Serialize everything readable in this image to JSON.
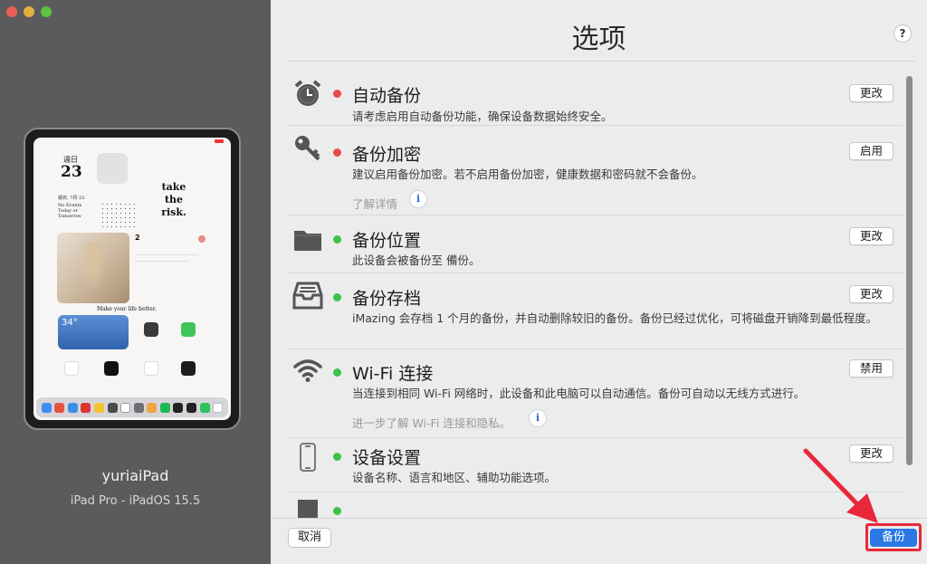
{
  "window": {
    "title": "选项"
  },
  "device": {
    "name": "yuriaiPad",
    "model": "iPad Pro - iPadOS 15.5",
    "screen": {
      "day_label": "週日",
      "day_number": "23",
      "quote": "take the risk.",
      "calendar_header": "週日, 7月 23",
      "calendar_text": "No Events Today or Tomorrow",
      "todo_count": "2",
      "caption": "Make your life better.",
      "weather_temp": "34°"
    }
  },
  "options": [
    {
      "icon": "alarm-clock-icon",
      "status": "red",
      "title": "自动备份",
      "description": "请考虑启用自动备份功能，确保设备数据始终安全。",
      "button": "更改"
    },
    {
      "icon": "key-icon",
      "status": "red",
      "title": "备份加密",
      "description": "建议启用备份加密。若不启用备份加密，健康数据和密码就不会备份。",
      "link": "了解详情",
      "button": "启用"
    },
    {
      "icon": "folder-icon",
      "status": "green",
      "title": "备份位置",
      "description": "此设备会被备份至 備份。",
      "button": "更改"
    },
    {
      "icon": "archive-tray-icon",
      "status": "green",
      "title": "备份存档",
      "description": "iMazing 会存档 1 个月的备份，并自动删除较旧的备份。备份已经过优化，可将磁盘开销降到最低程度。",
      "button": "更改"
    },
    {
      "icon": "wifi-icon",
      "status": "green",
      "title": "Wi-Fi 连接",
      "description": "当连接到相同 Wi-Fi 网络时，此设备和此电脑可以自动通信。备份可自动以无线方式进行。",
      "link": "进一步了解 Wi-Fi 连接和隐私。",
      "button": "禁用"
    },
    {
      "icon": "tablet-icon",
      "status": "green",
      "title": "设备设置",
      "description": "设备名称、语言和地区、辅助功能选项。",
      "button": "更改"
    }
  ],
  "footer": {
    "cancel_label": "取消",
    "backup_label": "备份"
  },
  "colors": {
    "accent": "#2b78e4",
    "status_red": "#e84a4a",
    "status_green": "#3cc24a",
    "highlight": "#e8283a"
  }
}
